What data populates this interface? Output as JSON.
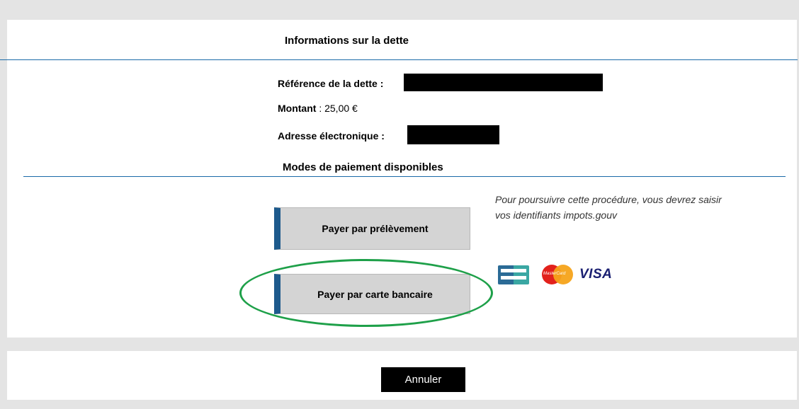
{
  "debt_section": {
    "title": "Informations sur la dette",
    "reference_label": "Référence de la dette :",
    "amount_label": "Montant",
    "amount_value": ": 25,00 €",
    "email_label": "Adresse électronique :"
  },
  "payment_section": {
    "title": "Modes de paiement disponibles",
    "direct_debit_button": "Payer par prélèvement",
    "note": "Pour poursuivre cette procédure, vous devrez saisir vos identifiants impots.gouv",
    "card_button": "Payer par carte bancaire",
    "card_logos": {
      "cb_icon": "cb-card-icon",
      "mastercard_icon": "mastercard-icon",
      "mastercard_text": "MasterCard",
      "visa_text": "VISA"
    }
  },
  "footer": {
    "cancel_button": "Annuler"
  },
  "colors": {
    "rule": "#1a6aa8",
    "button_accent": "#1d5a8c",
    "highlight_circle": "#1ea049"
  }
}
